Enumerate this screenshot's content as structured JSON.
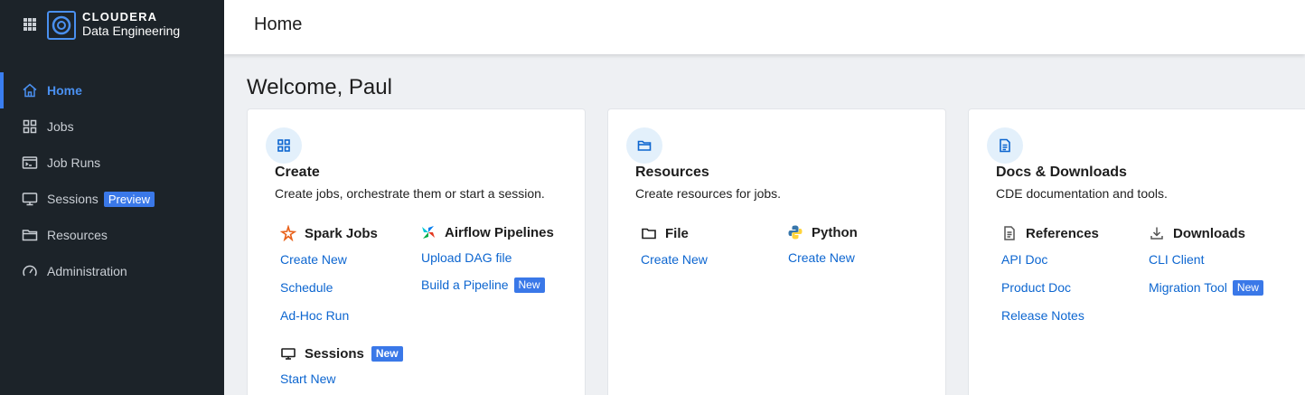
{
  "brand": {
    "name": "CLOUDERA",
    "product": "Data Engineering"
  },
  "nav": [
    {
      "label": "Home",
      "icon": "home-icon",
      "active": true
    },
    {
      "label": "Jobs",
      "icon": "grid-icon"
    },
    {
      "label": "Job Runs",
      "icon": "terminal-icon"
    },
    {
      "label": "Sessions",
      "icon": "monitor-icon",
      "badge": "Preview"
    },
    {
      "label": "Resources",
      "icon": "folder-icon"
    },
    {
      "label": "Administration",
      "icon": "gauge-icon"
    }
  ],
  "header": {
    "title": "Home"
  },
  "welcome": "Welcome, Paul",
  "colors": {
    "sidebar": "#1c2329",
    "accent": "#3a78e8",
    "link": "#0d66d0",
    "icon_bg": "#e3f0fb"
  },
  "cards": {
    "create": {
      "title": "Create",
      "desc": "Create jobs, orchestrate them or start a session.",
      "spark": {
        "label": "Spark Jobs",
        "links": [
          "Create New",
          "Schedule",
          "Ad-Hoc Run"
        ]
      },
      "airflow": {
        "label": "Airflow Pipelines",
        "links": [
          "Upload DAG file",
          "Build a Pipeline"
        ],
        "badge": "New"
      },
      "sessions": {
        "label": "Sessions",
        "badge": "New",
        "links": [
          "Start New"
        ]
      }
    },
    "resources": {
      "title": "Resources",
      "desc": "Create resources for jobs.",
      "file": {
        "label": "File",
        "links": [
          "Create New"
        ]
      },
      "python": {
        "label": "Python",
        "links": [
          "Create New"
        ]
      }
    },
    "docs": {
      "title": "Docs & Downloads",
      "desc": "CDE documentation and tools.",
      "references": {
        "label": "References",
        "links": [
          "API Doc",
          "Product Doc",
          "Release Notes"
        ]
      },
      "downloads": {
        "label": "Downloads",
        "links": [
          "CLI Client",
          "Migration Tool"
        ],
        "badge": "New"
      }
    }
  }
}
